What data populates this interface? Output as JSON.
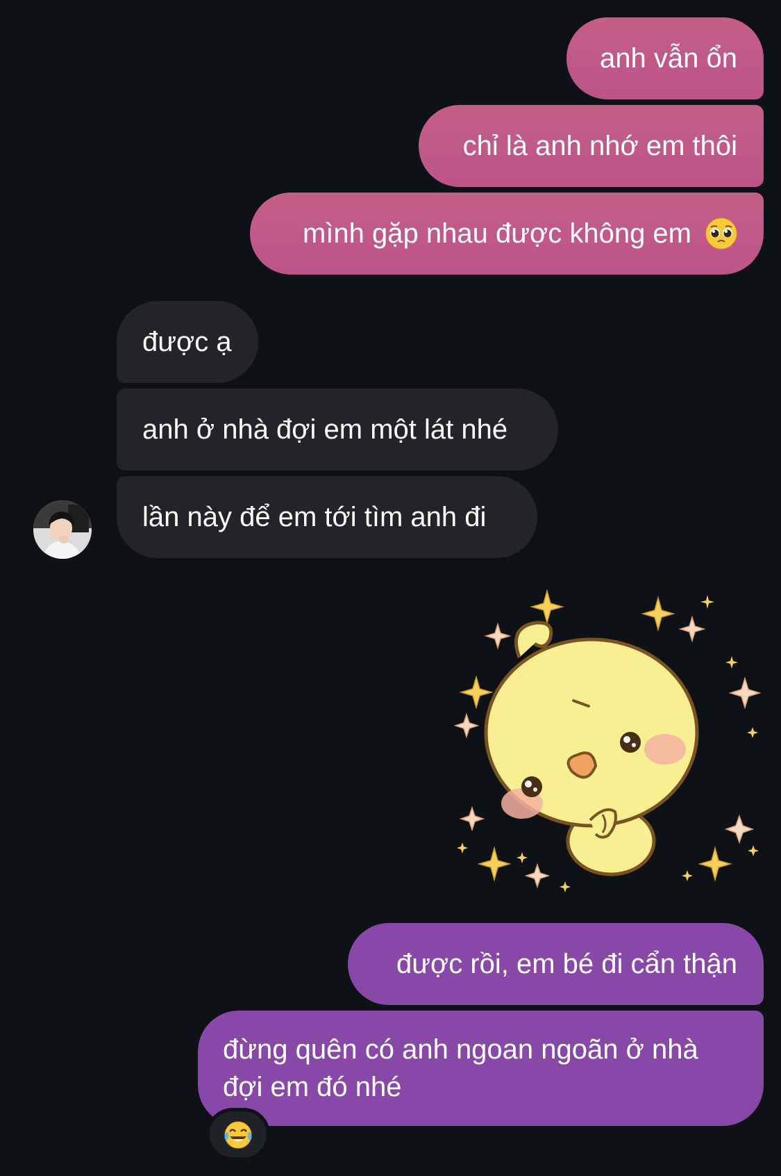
{
  "messages": {
    "m1": "anh vẫn ổn",
    "m2": "chỉ là anh nhớ em thôi",
    "m3": "mình gặp nhau được không em",
    "m3_emoji": "pleading-face-emoji",
    "m4": "được ạ",
    "m5": "anh ở nhà đợi em một lát nhé",
    "m6": "lần này để em tới tìm anh đi",
    "m7_sticker": "yellow-chick-sparkles-sticker",
    "m8": "được rồi, em bé đi cẩn thận",
    "m9_line1": "đừng quên có anh ngoan ngoãn ở nhà",
    "m9_line2": "đợi em đó nhé",
    "m9_reaction": "face-with-tears-of-joy-emoji"
  },
  "colors": {
    "background": "#0e1115",
    "outgoing_pink": "#c05a87",
    "outgoing_purple": "#8848a8",
    "incoming": "#222428"
  }
}
